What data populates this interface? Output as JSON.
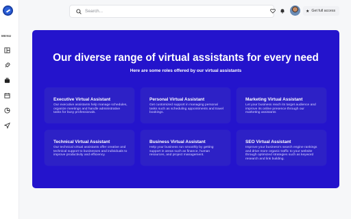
{
  "sidebar": {
    "menu_label": "MENU",
    "icons": [
      "logo-icon",
      "layout-icon",
      "rocket-icon",
      "briefcase-icon",
      "calendar-icon",
      "pie-chart-icon",
      "send-icon"
    ]
  },
  "topbar": {
    "search_placeholder": "Search...",
    "search_value": "",
    "cta_label": "Get full access"
  },
  "hero": {
    "title": "Our diverse range of virtual assistants for every need",
    "subtitle": "Here are some roles offered by our virtual assistants",
    "background_color": "#2414cc",
    "card_color": "#2d21c6"
  },
  "cards": [
    {
      "title": "Executive Virtual Assistant",
      "desc": "Our executive assistants help manage schedules, organize meetings and handle administrative tasks for busy professionals."
    },
    {
      "title": "Personal Virtual Assistant",
      "desc": "Get customized support in managing personal tasks such as scheduling appointments and travel bookings."
    },
    {
      "title": "Marketing Virtual Assistant",
      "desc": "Let your business reach its target audience and improve its online presence through our marketing assistants"
    },
    {
      "title": "Technical Virtual Assistant",
      "desc": "Our technical virtual assistants offer creative and technical support to businesses and individuals to improve productivity and efficiency."
    },
    {
      "title": "Business Virtual Assistant",
      "desc": "Help your business run smoothly by getting support in areas such as finance, human resources, and project management."
    },
    {
      "title": "SEO Virtual Assistant",
      "desc": "Improve your business's search engine rankings and drive more organic traffic to your website through optimized strategies such as keyword research and link building."
    }
  ]
}
